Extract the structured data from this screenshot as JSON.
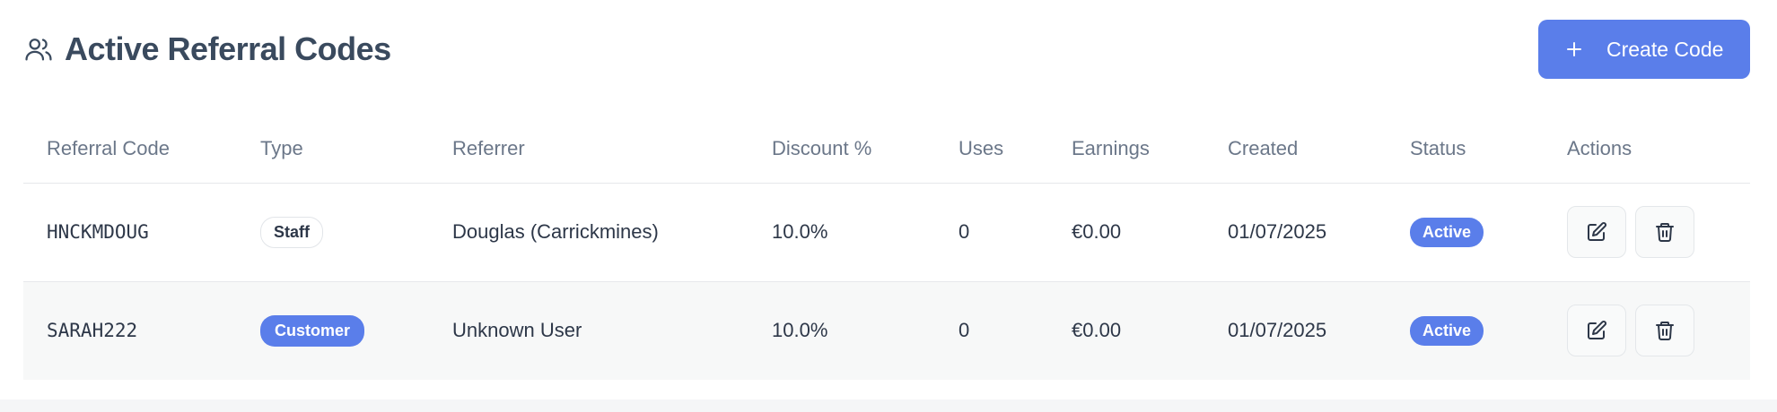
{
  "header": {
    "title": "Active Referral Codes",
    "title_icon": "users-icon",
    "create_button": {
      "label": "Create Code",
      "icon": "plus-icon"
    }
  },
  "table": {
    "columns": [
      "Referral Code",
      "Type",
      "Referrer",
      "Discount %",
      "Uses",
      "Earnings",
      "Created",
      "Status",
      "Actions"
    ],
    "rows": [
      {
        "code": "HNCKMDOUG",
        "type": "Staff",
        "referrer": "Douglas (Carrickmines)",
        "discount": "10.0%",
        "uses": "0",
        "earnings": "€0.00",
        "created": "01/07/2025",
        "status": "Active"
      },
      {
        "code": "SARAH222",
        "type": "Customer",
        "referrer": "Unknown User",
        "discount": "10.0%",
        "uses": "0",
        "earnings": "€0.00",
        "created": "01/07/2025",
        "status": "Active"
      }
    ],
    "action_icons": [
      "edit-icon",
      "trash-icon"
    ]
  },
  "colors": {
    "accent": "#5a7eea",
    "title": "#3a4a5e",
    "header_text": "#6b7789",
    "row_alt": "#f7f8f8"
  }
}
